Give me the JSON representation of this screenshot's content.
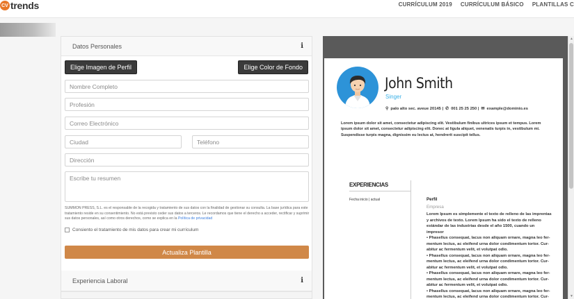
{
  "brand": {
    "badge": "CV",
    "name": "trends",
    "accent": "#e8782a"
  },
  "nav": [
    {
      "label": "CURRÍCULUM 2019"
    },
    {
      "label": "CURRÍCULUM BÁSICO"
    },
    {
      "label": "PLANTILLAS C"
    }
  ],
  "form": {
    "section_title": "Datos Personales",
    "profile_image_button": "Elige Imagen de Perfil",
    "bg_color_button": "Elige Color de Fondo",
    "fields": {
      "full_name": "Nombre Completo",
      "profession": "Profesión",
      "email": "Correo Electrónico",
      "city": "Ciudad",
      "phone": "Teléfono",
      "address": "Dirección",
      "summary": "Escribe tu resumen"
    },
    "legal_text": "SUMMON PRESS, S.L. es el responsable de la recogida y tratamiento de sus datos con la finalidad de gestionar su consulta. La base jurídica para este tratamiento reside en su consentimiento. No está previsto ceder sus datos a terceros. Le recordamos que tiene el derecho a acceder, rectificar y suprimir sus datos personales, así como otros derechos, como se explica en la",
    "legal_link": "Política de privacidad",
    "consent_label": "Consiento el tratamiento de mis datos para crear mi currículum",
    "update_button": "Actualiza Plantilla",
    "update_button_color": "#d08848",
    "experience_title": "Experiencia Laboral"
  },
  "cv": {
    "name": "John Smith",
    "title": "Singer",
    "address": "palo alto  sec. aveue 20145 |",
    "phone": "001 25 25 250  |",
    "email": "example@dominio.es",
    "summary": "Lorem ipsum dolor sit amet, consectetur adipiscing elit. Vestibulum finibus ultrices ipsum et tempus. Lorem ipsum dolor sit amet, consectetur adipiscing elit. Donec at ligula aliquet, venenatis turpis in, vestibulum mi. Suspendisse turpis magna, dignissim eu lectus at, hendrerit suscipit tellus.",
    "experience_heading": "EXPERIENCIAS",
    "date_label": "Fecha inicio | actual",
    "job_title": "Perfil",
    "company": "Empresa",
    "job_intro": "Lorem Ipsum es simplemente el texto de relleno de las imprentas y archivos de texto. Lorem Ipsum ha sido el texto de relleno estándar de las industrias desde el año 1500, cuando un impresor",
    "bullets": [
      "• Phasellus consequat, lacus non aliquam ornare, magna leo fer- mentum lectus, ac eleifend urna dolor condimentum tortor. Cur- abitur ac fermentum velit, et volutpat odio.",
      "• Phasellus consequat, lacus non aliquam ornare, magna leo fer- mentum lectus, ac eleifend urna dolor condimentum tortor. Cur- abitur ac fermentum velit, et volutpat odio.",
      "• Phasellus consequat, lacus non aliquam ornare, magna leo fer- mentum lectus, ac eleifend urna dolor condimentum tortor. Cur- abitur ac fermentum velit, et volutpat odio.",
      "• Phasellus consequat, lacus non aliquam ornare, magna leo fer- mentum lectus, ac eleifend urna dolor condimentum tortor. Cur- abitur ac fermentum velit, et volutpat odio."
    ],
    "title_color": "#3ab0e6",
    "avatar_bg": "#2d93d8"
  },
  "icons": {
    "info": "info-icon",
    "location": "location-pin-icon",
    "phone": "phone-icon",
    "email": "envelope-icon"
  }
}
